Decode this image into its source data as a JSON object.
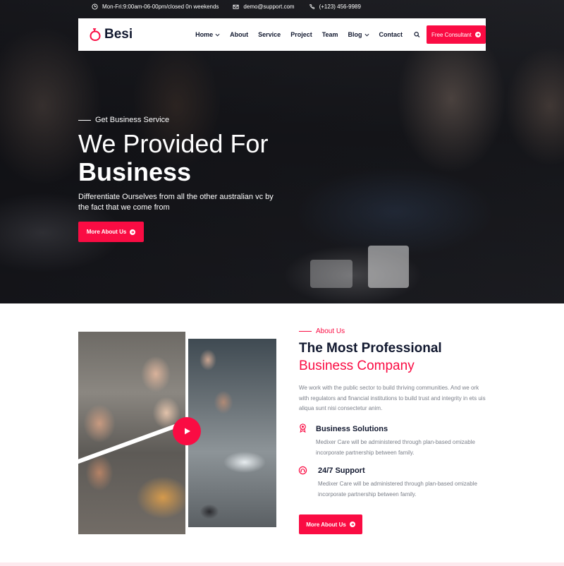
{
  "topbar": {
    "hours": "Mon-Fri:9:00am-06-00pm/closed 0n weekends",
    "email": "demo@support.com",
    "phone": "(+123) 456-9989"
  },
  "brand": {
    "name": "Besi",
    "accent": "#fa0c43",
    "dark": "#11182f"
  },
  "nav": {
    "items": [
      {
        "label": "Home",
        "dropdown": true
      },
      {
        "label": "About",
        "dropdown": false
      },
      {
        "label": "Service",
        "dropdown": false
      },
      {
        "label": "Project",
        "dropdown": false
      },
      {
        "label": "Team",
        "dropdown": false
      },
      {
        "label": "Blog",
        "dropdown": true
      },
      {
        "label": "Contact",
        "dropdown": false
      }
    ],
    "cta": "Free Consultant"
  },
  "hero": {
    "eyebrow": "Get Business Service",
    "title_line1": "We Provided For",
    "title_line2": "Business",
    "description": "Differentiate Ourselves from all the other australian vc by the fact that we come from",
    "button": "More About Us"
  },
  "about": {
    "eyebrow": "About Us",
    "title": "The Most Professional",
    "subtitle": "Business Company",
    "description": "We work with the public sector to build thriving communities. And we ork with regulators and financial institutions to build trust and integrity in ets uis aliqua sunt nisi consectetur anim.",
    "features": [
      {
        "icon": "award-icon",
        "title": "Business Solutions",
        "description": "Medixer Care will be administered through plan-based omizable incorporate partnership between family."
      },
      {
        "icon": "support-icon",
        "title": "24/7 Support",
        "description": "Medixer Care will be administered through plan-based omizable incorporate partnership between family."
      }
    ],
    "button": "More About Us"
  }
}
